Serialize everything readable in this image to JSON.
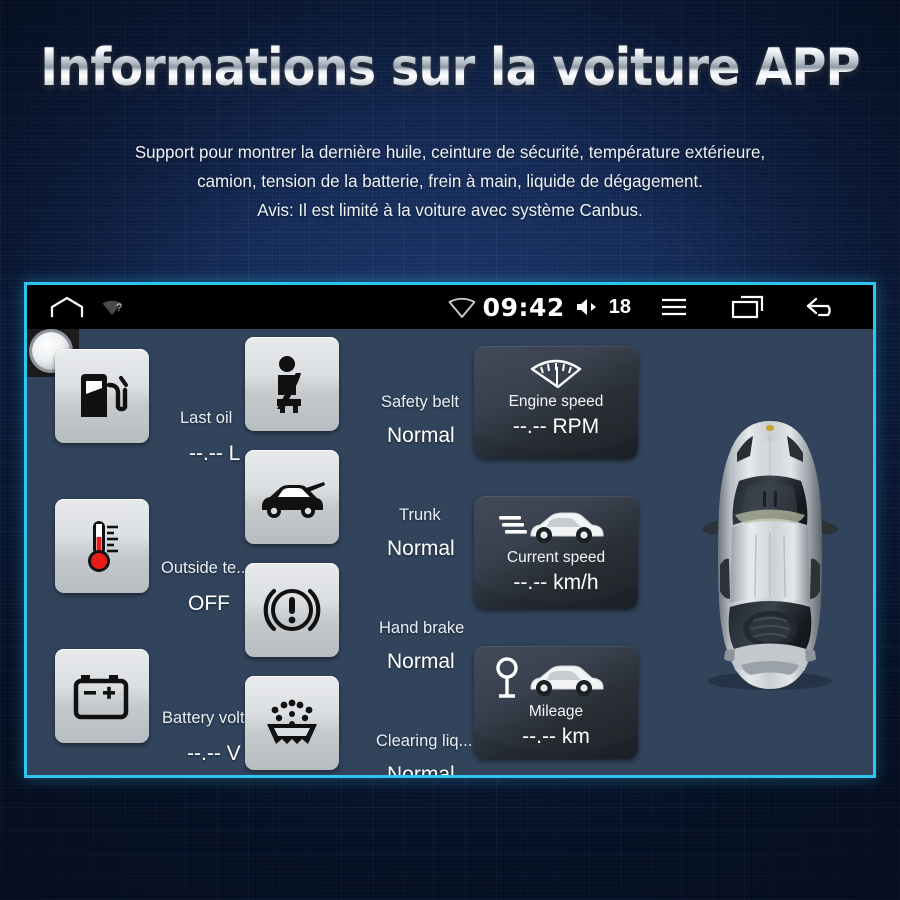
{
  "page": {
    "title": "Informations sur la voiture APP",
    "subtitle_lines": [
      "Support pour montrer la dernière huile, ceinture de sécurité, température extérieure,",
      "camion, tension de la batterie, frein à main, liquide de dégagement.",
      "Avis: Il est limité à la voiture avec système Canbus."
    ],
    "accent_color": "#2ec5f0",
    "background_color": "#0d1d3e",
    "app_background_color": "#31445c"
  },
  "statusbar": {
    "background_color": "#000000",
    "left_icons": [
      {
        "name": "home-icon",
        "label": "Home"
      },
      {
        "name": "signal-question-icon",
        "label": "Signal unknown"
      }
    ],
    "wifi_icon": "wifi-icon",
    "time": "09:42",
    "volume_icon": "volume-icon",
    "volume_level": "18",
    "nav_icons": [
      {
        "name": "menu-icon",
        "label": "Menu"
      },
      {
        "name": "recents-icon",
        "label": "Recent apps"
      },
      {
        "name": "back-icon",
        "label": "Back"
      }
    ]
  },
  "home_button": {
    "name": "home-hardware-button"
  },
  "car_info": {
    "indicators": [
      {
        "icon": "fuel-pump-icon",
        "label": "Last oil",
        "value": "--.-- L"
      },
      {
        "icon": "thermometer-icon",
        "label": "Outside te...",
        "value": "OFF"
      },
      {
        "icon": "battery-icon",
        "label": "Battery volt...",
        "value": "--.-- V"
      },
      {
        "icon": "seatbelt-icon",
        "label": "Safety belt",
        "value": "Normal"
      },
      {
        "icon": "trunk-open-icon",
        "label": "Trunk",
        "value": "Normal"
      },
      {
        "icon": "hand-brake-icon",
        "label": "Hand brake",
        "value": "Normal"
      },
      {
        "icon": "washer-fluid-icon",
        "label": "Clearing liq...",
        "value": "Normal"
      }
    ],
    "gauges": [
      {
        "icon": "tachometer-icon",
        "label": "Engine speed",
        "value": "--.-- RPM"
      },
      {
        "icon": "speed-car-icon",
        "label": "Current speed",
        "value": "--.-- km/h"
      },
      {
        "icon": "milestone-car-icon",
        "label": "Mileage",
        "value": "--.-- km"
      }
    ],
    "vehicle_image": "car-top-view-silver"
  }
}
